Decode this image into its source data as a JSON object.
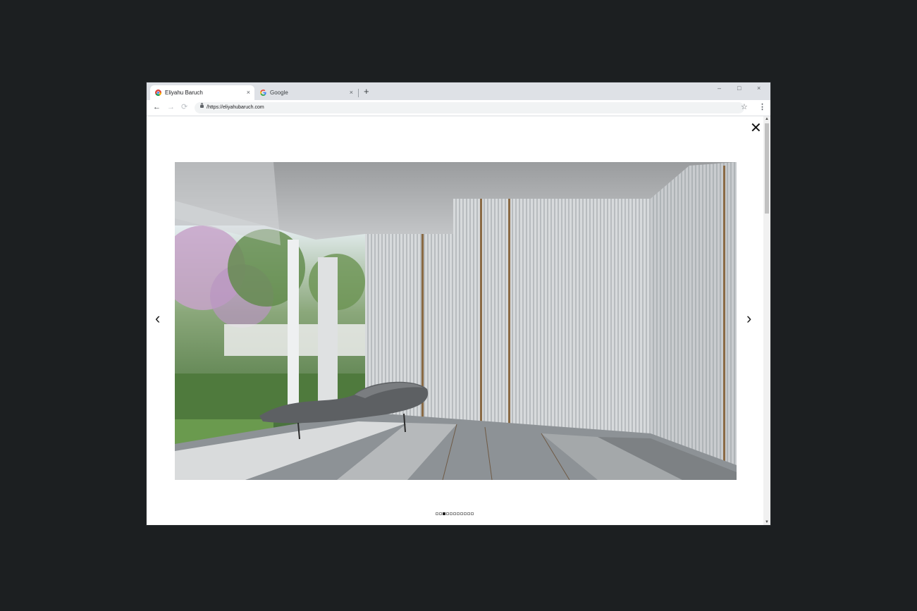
{
  "browser": {
    "tabs": [
      {
        "title": "Eliyahu Baruch",
        "active": true,
        "favicon": "chrome-icon"
      },
      {
        "title": "Google",
        "active": false,
        "favicon": "google-icon"
      }
    ],
    "new_tab_glyph": "+",
    "tab_close_glyph": "×",
    "window_controls": {
      "minimize": "–",
      "maximize": "□",
      "close": "×"
    },
    "nav": {
      "back": "←",
      "forward": "→",
      "reload": "⟳"
    },
    "url": "/https://eliyahubaruch.com",
    "star_glyph": "☆",
    "menu_glyph": "⋮"
  },
  "lightbox": {
    "close_glyph": "✕",
    "prev_glyph": "‹",
    "next_glyph": "›",
    "image_icon": "interior-render-image",
    "slides_total": 11,
    "active_slide": 3
  },
  "colors": {
    "desktop_bg": "#1c1f21",
    "tabstrip_bg": "#dee1e6",
    "omnibox_bg": "#f1f3f4"
  }
}
